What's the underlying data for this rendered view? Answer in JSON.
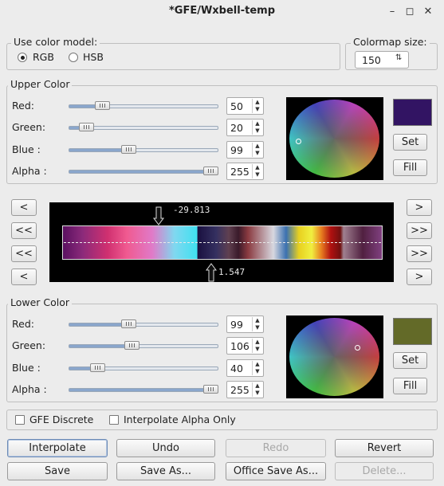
{
  "window": {
    "title": "*GFE/Wxbell-temp"
  },
  "color_model": {
    "legend": "Use color model:",
    "options": [
      {
        "label": "RGB",
        "selected": true
      },
      {
        "label": "HSB",
        "selected": false
      }
    ]
  },
  "colormap_size": {
    "legend": "Colormap size:",
    "value": "150"
  },
  "upper": {
    "legend": "Upper Color",
    "channels": [
      {
        "label": "Red:",
        "value": "50",
        "level": 0.196
      },
      {
        "label": "Green:",
        "value": "20",
        "level": 0.078
      },
      {
        "label": "Blue :",
        "value": "99",
        "level": 0.388
      },
      {
        "label": "Alpha :",
        "value": "255",
        "level": 1.0
      }
    ],
    "swatch_color": "#321463",
    "set_label": "Set",
    "fill_label": "Fill"
  },
  "lower": {
    "legend": "Lower Color",
    "channels": [
      {
        "label": "Red:",
        "value": "99",
        "level": 0.388
      },
      {
        "label": "Green:",
        "value": "106",
        "level": 0.416
      },
      {
        "label": "Blue :",
        "value": "40",
        "level": 0.157
      },
      {
        "label": "Alpha :",
        "value": "255",
        "level": 1.0
      }
    ],
    "swatch_color": "#636a28",
    "set_label": "Set",
    "fill_label": "Fill"
  },
  "colormap": {
    "upper_marker_value": "-29.813",
    "lower_marker_value": "1.547",
    "left_buttons": [
      "<",
      "<<",
      "<<",
      "<"
    ],
    "right_buttons": [
      ">",
      ">>",
      ">>",
      ">"
    ]
  },
  "options": {
    "gfe_discrete": {
      "label": "GFE Discrete",
      "checked": false
    },
    "interpolate_alpha": {
      "label": "Interpolate Alpha Only",
      "checked": false
    }
  },
  "actions": {
    "interpolate": "Interpolate",
    "undo": "Undo",
    "redo": "Redo",
    "revert": "Revert",
    "save": "Save",
    "save_as": "Save As...",
    "office_save_as": "Office Save As...",
    "delete": "Delete..."
  }
}
